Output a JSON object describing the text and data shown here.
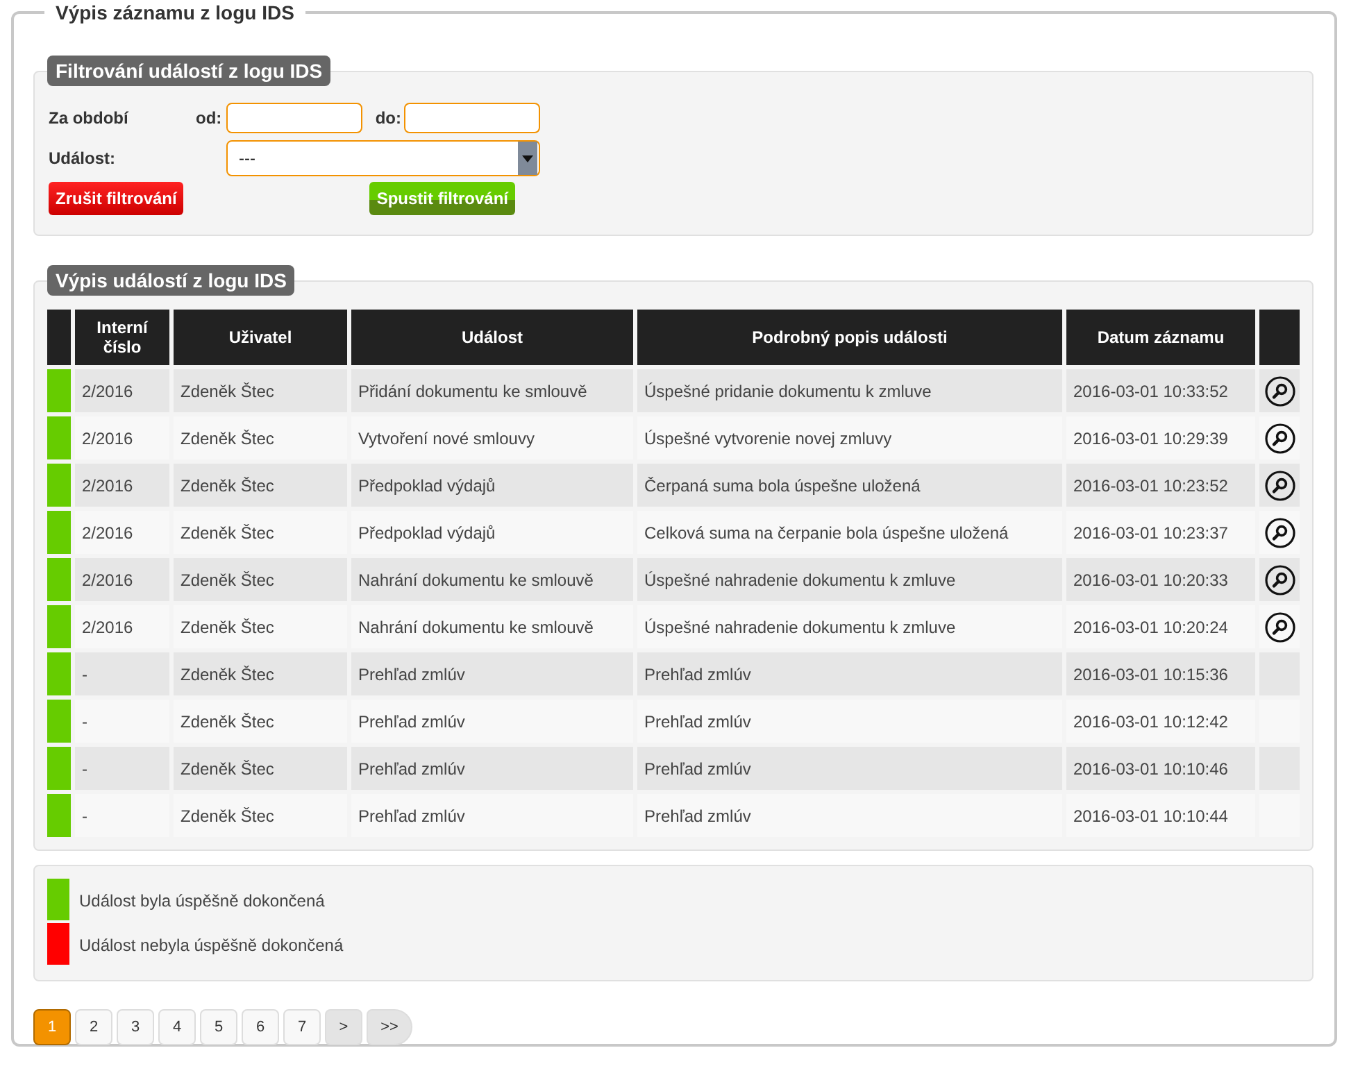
{
  "title": "Výpis záznamu z logu IDS",
  "filter": {
    "title": "Filtrování událostí z logu IDS",
    "period_label": "Za období",
    "from_label": "od:",
    "to_label": "do:",
    "event_label": "Událost:",
    "event_value": "---",
    "cancel_button": "Zrušit filtrování",
    "run_button": "Spustit filtrování"
  },
  "list": {
    "title": "Výpis událostí z logu IDS",
    "columns": [
      "Interní číslo",
      "Uživatel",
      "Událost",
      "Podrobný popis události",
      "Datum záznamu"
    ],
    "rows": [
      {
        "color": "#66cc00",
        "number": "2/2016",
        "user": "Zdeněk Štec",
        "event": "Přidání dokumentu ke smlouvě",
        "description": "Úspešné pridanie dokumentu k zmluve",
        "date": "2016-03-01 10:33:52",
        "has_detail": true
      },
      {
        "color": "#66cc00",
        "number": "2/2016",
        "user": "Zdeněk Štec",
        "event": "Vytvoření nové smlouvy",
        "description": "Úspešné vytvorenie novej zmluvy",
        "date": "2016-03-01 10:29:39",
        "has_detail": true
      },
      {
        "color": "#66cc00",
        "number": "2/2016",
        "user": "Zdeněk Štec",
        "event": "Předpoklad výdajů",
        "description": "Čerpaná suma bola úspešne uložená",
        "date": "2016-03-01 10:23:52",
        "has_detail": true
      },
      {
        "color": "#66cc00",
        "number": "2/2016",
        "user": "Zdeněk Štec",
        "event": "Předpoklad výdajů",
        "description": "Celková suma na čerpanie bola úspešne uložená",
        "date": "2016-03-01 10:23:37",
        "has_detail": true
      },
      {
        "color": "#66cc00",
        "number": "2/2016",
        "user": "Zdeněk Štec",
        "event": "Nahrání dokumentu ke smlouvě",
        "description": "Úspešné nahradenie dokumentu k zmluve",
        "date": "2016-03-01 10:20:33",
        "has_detail": true
      },
      {
        "color": "#66cc00",
        "number": "2/2016",
        "user": "Zdeněk Štec",
        "event": "Nahrání dokumentu ke smlouvě",
        "description": "Úspešné nahradenie dokumentu k zmluve",
        "date": "2016-03-01 10:20:24",
        "has_detail": true
      },
      {
        "color": "#66cc00",
        "number": "-",
        "user": "Zdeněk Štec",
        "event": "Prehľad zmlúv",
        "description": "Prehľad zmlúv",
        "date": "2016-03-01 10:15:36",
        "has_detail": false
      },
      {
        "color": "#66cc00",
        "number": "-",
        "user": "Zdeněk Štec",
        "event": "Prehľad zmlúv",
        "description": "Prehľad zmlúv",
        "date": "2016-03-01 10:12:42",
        "has_detail": false
      },
      {
        "color": "#66cc00",
        "number": "-",
        "user": "Zdeněk Štec",
        "event": "Prehľad zmlúv",
        "description": "Prehľad zmlúv",
        "date": "2016-03-01 10:10:46",
        "has_detail": false
      },
      {
        "color": "#66cc00",
        "number": "-",
        "user": "Zdeněk Štec",
        "event": "Prehľad zmlúv",
        "description": "Prehľad zmlúv",
        "date": "2016-03-01 10:10:44",
        "has_detail": false
      }
    ]
  },
  "legend": [
    {
      "color": "#66cc00",
      "label": "Událost byla úspěšně dokončená"
    },
    {
      "color": "#ff0000",
      "label": "Událost nebyla úspěšně dokončená"
    }
  ],
  "pagination": [
    {
      "kind": "page",
      "label": "1",
      "selected": true
    },
    {
      "kind": "page",
      "label": "2",
      "selected": false
    },
    {
      "kind": "page",
      "label": "3",
      "selected": false
    },
    {
      "kind": "page",
      "label": "4",
      "selected": false
    },
    {
      "kind": "page",
      "label": "5",
      "selected": false
    },
    {
      "kind": "page",
      "label": "6",
      "selected": false
    },
    {
      "kind": "page",
      "label": "7",
      "selected": false
    },
    {
      "kind": "next",
      "label": ">",
      "selected": false
    },
    {
      "kind": "last",
      "label": ">>",
      "selected": false
    }
  ]
}
